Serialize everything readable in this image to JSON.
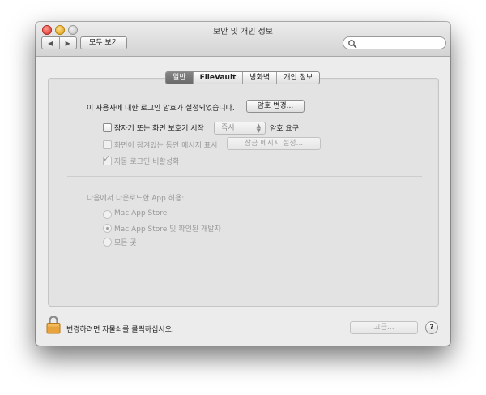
{
  "window": {
    "title": "보안 및 개인 정보"
  },
  "toolbar": {
    "back_icon": "chevron-left-icon",
    "forward_icon": "chevron-right-icon",
    "back_label": "◀",
    "forward_label": "▶",
    "show_all_label": "모두 보기",
    "search_placeholder": ""
  },
  "tabs": [
    {
      "label": "일반",
      "active": true
    },
    {
      "label": "FileVault",
      "active": false
    },
    {
      "label": "방화벽",
      "active": false
    },
    {
      "label": "개인 정보",
      "active": false
    }
  ],
  "general": {
    "password_set_text": "이 사용자에 대한 로그인 암호가 설정되었습니다.",
    "change_password_label": "암호 변경...",
    "require_password": {
      "label": "잠자기 또는 화면 보호기 시작",
      "checked": false,
      "select_value": "즉시",
      "suffix": "암호 요구"
    },
    "show_message": {
      "label": "화면이 잠겨있는 동안 메시지 표시",
      "checked": false,
      "enabled": false,
      "button_label": "잠금 메시지 설정..."
    },
    "disable_auto_login": {
      "label": "자동 로그인 비활성화",
      "checked": true,
      "enabled": false,
      "check_glyph": "✓"
    },
    "allow_apps_heading": "다음에서 다운로드한 App 허용:",
    "allow_apps_options": [
      {
        "label": "Mac App Store",
        "selected": false
      },
      {
        "label": "Mac App Store 및 확인된 개발자",
        "selected": true
      },
      {
        "label": "모든 곳",
        "selected": false
      }
    ]
  },
  "footer": {
    "lock_text": "변경하려면 자물쇠를 클릭하십시오.",
    "advanced_label": "고급...",
    "help_label": "?"
  },
  "colors": {
    "active_tab": "#777777",
    "window_bg": "#ececec",
    "panel_bg": "#e3e3e3",
    "lock": "#e8a33c"
  }
}
